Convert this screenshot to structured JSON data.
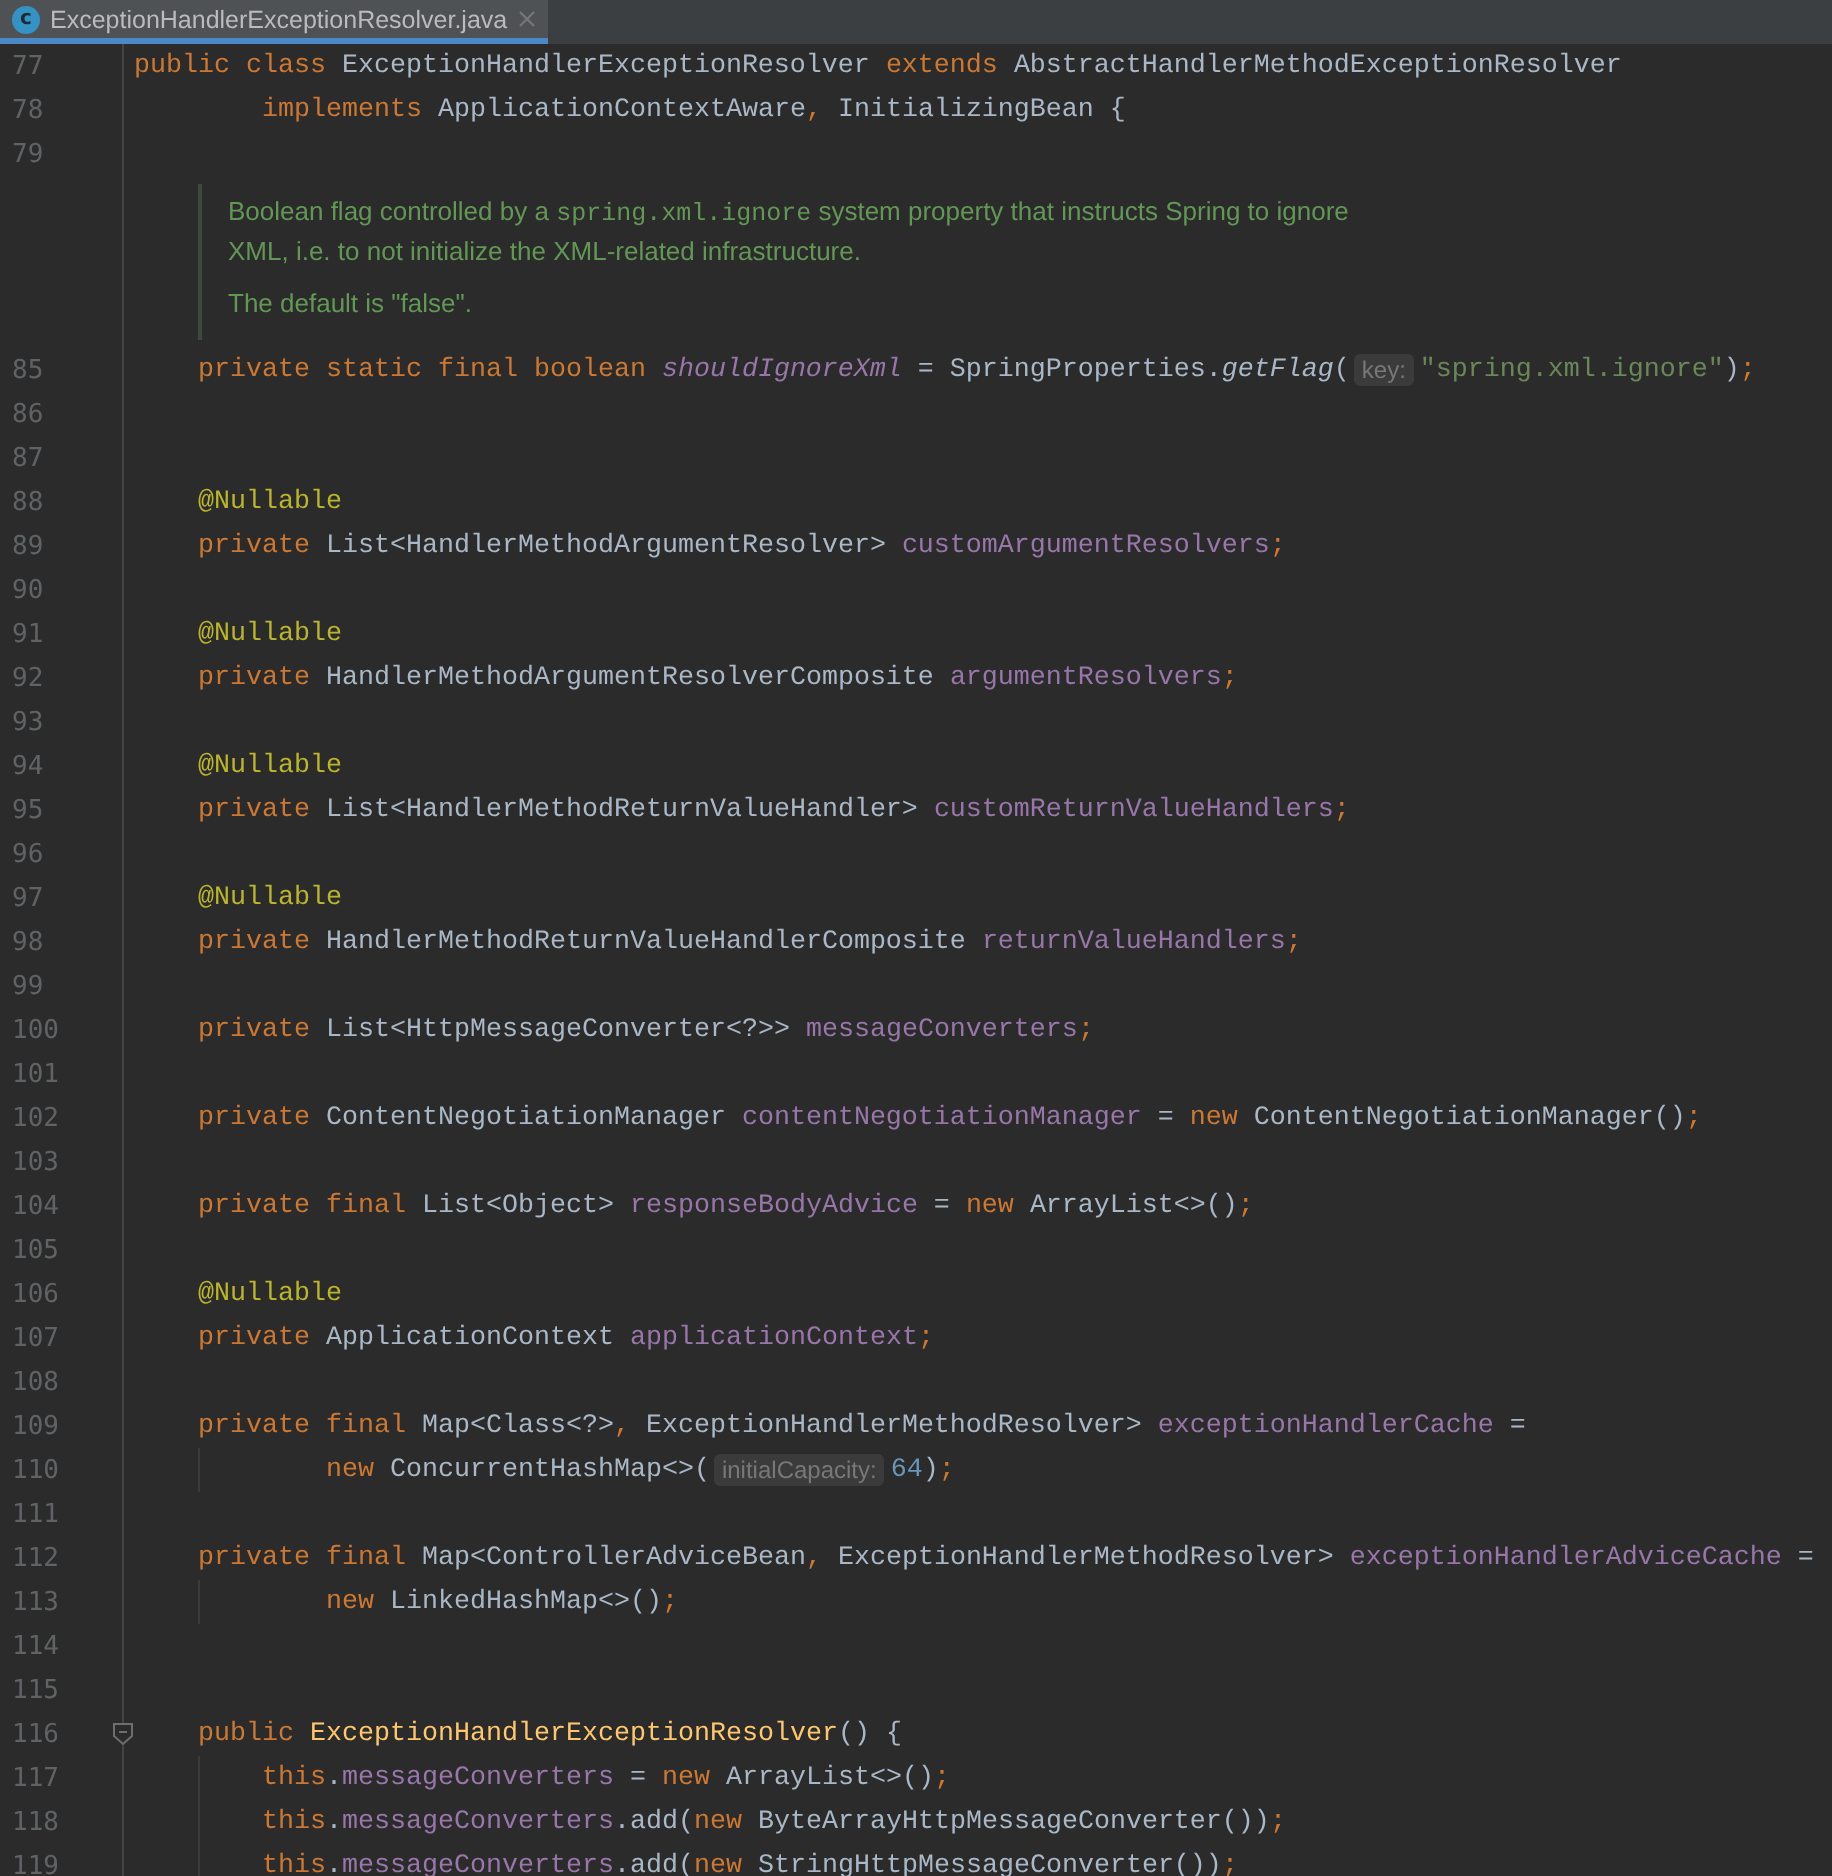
{
  "tab": {
    "icon_label": "c",
    "title": "ExceptionHandlerExceptionResolver.java",
    "selected": true
  },
  "lines": [
    {
      "kind": "declaration",
      "n": "77",
      "parts": [
        {
          "text": "public class ",
          "kind": "kw"
        },
        {
          "text": "ExceptionHandlerExceptionResolver ",
          "kind": "plain"
        },
        {
          "text": "extends ",
          "kind": "kw"
        },
        {
          "text": "AbstractHandlerMethodExceptionResolver",
          "kind": "plain"
        }
      ]
    },
    {
      "kind": "class-continuation",
      "n": "78",
      "parts": [
        {
          "text": "implements ",
          "kind": "kw"
        },
        {
          "text": "ApplicationContextAware",
          "kind": "plain"
        },
        {
          "text": ", ",
          "kind": "kw"
        },
        {
          "text": "InitializingBean {",
          "kind": "plain"
        }
      ]
    },
    {
      "kind": "blank",
      "n": "79"
    },
    {
      "kind": "doc",
      "paragraphs": [
        {
          "lines": [
            {
              "spans": [
                {
                  "text": "Boolean flag controlled by a ",
                  "kind": "text"
                },
                {
                  "text": "spring.xml.ignore",
                  "kind": "code"
                },
                {
                  "text": " system property that instructs Spring to ignore",
                  "kind": "text"
                }
              ]
            },
            {
              "spans": [
                {
                  "text": "XML, i.e. to not initialize the XML-related infrastructure.",
                  "kind": "text"
                }
              ]
            }
          ]
        },
        {
          "lines": [
            {
              "spans": [
                {
                  "text": "The default is \"false\".",
                  "kind": "text"
                }
              ]
            }
          ]
        }
      ]
    },
    {
      "kind": "member",
      "n": "85",
      "parts": [
        {
          "text": "private static final boolean ",
          "kind": "kw"
        },
        {
          "text": "shouldIgnoreXml",
          "kind": "static"
        },
        {
          "text": " = SpringProperties.",
          "kind": "plain"
        },
        {
          "text": "getFlag",
          "kind": "call"
        },
        {
          "text": "(",
          "kind": "plain"
        },
        {
          "text": "key:",
          "kind": "hint"
        },
        {
          "text": "\"spring.xml.ignore\"",
          "kind": "str"
        },
        {
          "text": ")",
          "kind": "plain"
        },
        {
          "text": ";",
          "kind": "kw"
        }
      ]
    },
    {
      "kind": "blank",
      "n": "86"
    },
    {
      "kind": "blank",
      "n": "87"
    },
    {
      "kind": "member",
      "n": "88",
      "parts": [
        {
          "text": "@Nullable",
          "kind": "ann"
        }
      ]
    },
    {
      "kind": "member",
      "n": "89",
      "parts": [
        {
          "text": "private ",
          "kind": "kw"
        },
        {
          "text": "List<HandlerMethodArgumentResolver> ",
          "kind": "plain"
        },
        {
          "text": "customArgumentResolvers",
          "kind": "field"
        },
        {
          "text": ";",
          "kind": "kw"
        }
      ]
    },
    {
      "kind": "blank",
      "n": "90"
    },
    {
      "kind": "member",
      "n": "91",
      "parts": [
        {
          "text": "@Nullable",
          "kind": "ann"
        }
      ]
    },
    {
      "kind": "member",
      "n": "92",
      "parts": [
        {
          "text": "private ",
          "kind": "kw"
        },
        {
          "text": "HandlerMethodArgumentResolverComposite ",
          "kind": "plain"
        },
        {
          "text": "argumentResolvers",
          "kind": "field"
        },
        {
          "text": ";",
          "kind": "kw"
        }
      ]
    },
    {
      "kind": "blank",
      "n": "93"
    },
    {
      "kind": "member",
      "n": "94",
      "parts": [
        {
          "text": "@Nullable",
          "kind": "ann"
        }
      ]
    },
    {
      "kind": "member",
      "n": "95",
      "parts": [
        {
          "text": "private ",
          "kind": "kw"
        },
        {
          "text": "List<HandlerMethodReturnValueHandler> ",
          "kind": "plain"
        },
        {
          "text": "customReturnValueHandlers",
          "kind": "field"
        },
        {
          "text": ";",
          "kind": "kw"
        }
      ]
    },
    {
      "kind": "blank",
      "n": "96"
    },
    {
      "kind": "member",
      "n": "97",
      "parts": [
        {
          "text": "@Nullable",
          "kind": "ann"
        }
      ]
    },
    {
      "kind": "member",
      "n": "98",
      "parts": [
        {
          "text": "private ",
          "kind": "kw"
        },
        {
          "text": "HandlerMethodReturnValueHandlerComposite ",
          "kind": "plain"
        },
        {
          "text": "returnValueHandlers",
          "kind": "field"
        },
        {
          "text": ";",
          "kind": "kw"
        }
      ]
    },
    {
      "kind": "blank",
      "n": "99"
    },
    {
      "kind": "member",
      "n": "100",
      "parts": [
        {
          "text": "private ",
          "kind": "kw"
        },
        {
          "text": "List<HttpMessageConverter<?>> ",
          "kind": "plain"
        },
        {
          "text": "messageConverters",
          "kind": "field"
        },
        {
          "text": ";",
          "kind": "kw"
        }
      ]
    },
    {
      "kind": "blank",
      "n": "101"
    },
    {
      "kind": "member",
      "n": "102",
      "parts": [
        {
          "text": "private ",
          "kind": "kw"
        },
        {
          "text": "ContentNegotiationManager ",
          "kind": "plain"
        },
        {
          "text": "contentNegotiationManager",
          "kind": "field"
        },
        {
          "text": " = ",
          "kind": "plain"
        },
        {
          "text": "new ",
          "kind": "kw"
        },
        {
          "text": "ContentNegotiationManager()",
          "kind": "plain"
        },
        {
          "text": ";",
          "kind": "kw"
        }
      ]
    },
    {
      "kind": "blank",
      "n": "103"
    },
    {
      "kind": "member",
      "n": "104",
      "parts": [
        {
          "text": "private final ",
          "kind": "kw"
        },
        {
          "text": "List<Object> ",
          "kind": "plain"
        },
        {
          "text": "responseBodyAdvice",
          "kind": "field"
        },
        {
          "text": " = ",
          "kind": "plain"
        },
        {
          "text": "new ",
          "kind": "kw"
        },
        {
          "text": "ArrayList<>()",
          "kind": "plain"
        },
        {
          "text": ";",
          "kind": "kw"
        }
      ]
    },
    {
      "kind": "blank",
      "n": "105"
    },
    {
      "kind": "member",
      "n": "106",
      "parts": [
        {
          "text": "@Nullable",
          "kind": "ann"
        }
      ]
    },
    {
      "kind": "member",
      "n": "107",
      "parts": [
        {
          "text": "private ",
          "kind": "kw"
        },
        {
          "text": "ApplicationContext ",
          "kind": "plain"
        },
        {
          "text": "applicationContext",
          "kind": "field"
        },
        {
          "text": ";",
          "kind": "kw"
        }
      ]
    },
    {
      "kind": "blank",
      "n": "108"
    },
    {
      "kind": "member",
      "n": "109",
      "parts": [
        {
          "text": "private final ",
          "kind": "kw"
        },
        {
          "text": "Map<Class<?>",
          "kind": "plain"
        },
        {
          "text": ", ",
          "kind": "kw"
        },
        {
          "text": "ExceptionHandlerMethodResolver> ",
          "kind": "plain"
        },
        {
          "text": "exceptionHandlerCache",
          "kind": "field"
        },
        {
          "text": " =",
          "kind": "plain"
        }
      ]
    },
    {
      "kind": "member-continuation",
      "n": "110",
      "parts": [
        {
          "text": "new ",
          "kind": "kw"
        },
        {
          "text": "ConcurrentHashMap<>(",
          "kind": "plain"
        },
        {
          "text": "initialCapacity:",
          "kind": "hint"
        },
        {
          "text": "64",
          "kind": "num"
        },
        {
          "text": ")",
          "kind": "plain"
        },
        {
          "text": ";",
          "kind": "kw"
        }
      ]
    },
    {
      "kind": "blank",
      "n": "111"
    },
    {
      "kind": "member",
      "n": "112",
      "parts": [
        {
          "text": "private final ",
          "kind": "kw"
        },
        {
          "text": "Map<ControllerAdviceBean",
          "kind": "plain"
        },
        {
          "text": ", ",
          "kind": "kw"
        },
        {
          "text": "ExceptionHandlerMethodResolver> ",
          "kind": "plain"
        },
        {
          "text": "exceptionHandlerAdviceCache",
          "kind": "field"
        },
        {
          "text": " =",
          "kind": "plain"
        }
      ]
    },
    {
      "kind": "member-continuation",
      "n": "113",
      "parts": [
        {
          "text": "new ",
          "kind": "kw"
        },
        {
          "text": "LinkedHashMap<>()",
          "kind": "plain"
        },
        {
          "text": ";",
          "kind": "kw"
        }
      ]
    },
    {
      "kind": "blank",
      "n": "114"
    },
    {
      "kind": "blank",
      "n": "115"
    },
    {
      "kind": "method-start",
      "n": "116",
      "parts": [
        {
          "text": "public ",
          "kind": "kw"
        },
        {
          "text": "ExceptionHandlerExceptionResolver",
          "kind": "decl"
        },
        {
          "text": "() {",
          "kind": "plain"
        }
      ]
    },
    {
      "kind": "statement",
      "n": "117",
      "parts": [
        {
          "text": "this",
          "kind": "kw"
        },
        {
          "text": ".",
          "kind": "plain"
        },
        {
          "text": "messageConverters",
          "kind": "field"
        },
        {
          "text": " = ",
          "kind": "plain"
        },
        {
          "text": "new ",
          "kind": "kw"
        },
        {
          "text": "ArrayList<>()",
          "kind": "plain"
        },
        {
          "text": ";",
          "kind": "kw"
        }
      ]
    },
    {
      "kind": "statement",
      "n": "118",
      "parts": [
        {
          "text": "this",
          "kind": "kw"
        },
        {
          "text": ".",
          "kind": "plain"
        },
        {
          "text": "messageConverters",
          "kind": "field"
        },
        {
          "text": ".add(",
          "kind": "plain"
        },
        {
          "text": "new ",
          "kind": "kw"
        },
        {
          "text": "ByteArrayHttpMessageConverter())",
          "kind": "plain"
        },
        {
          "text": ";",
          "kind": "kw"
        }
      ]
    },
    {
      "kind": "statement",
      "n": "119",
      "parts": [
        {
          "text": "this",
          "kind": "kw"
        },
        {
          "text": ".",
          "kind": "plain"
        },
        {
          "text": "messageConverters",
          "kind": "field"
        },
        {
          "text": ".add(",
          "kind": "plain"
        },
        {
          "text": "new ",
          "kind": "kw"
        },
        {
          "text": "StringHttpMessageConverter())",
          "kind": "plain"
        },
        {
          "text": ";",
          "kind": "kw"
        }
      ]
    }
  ]
}
